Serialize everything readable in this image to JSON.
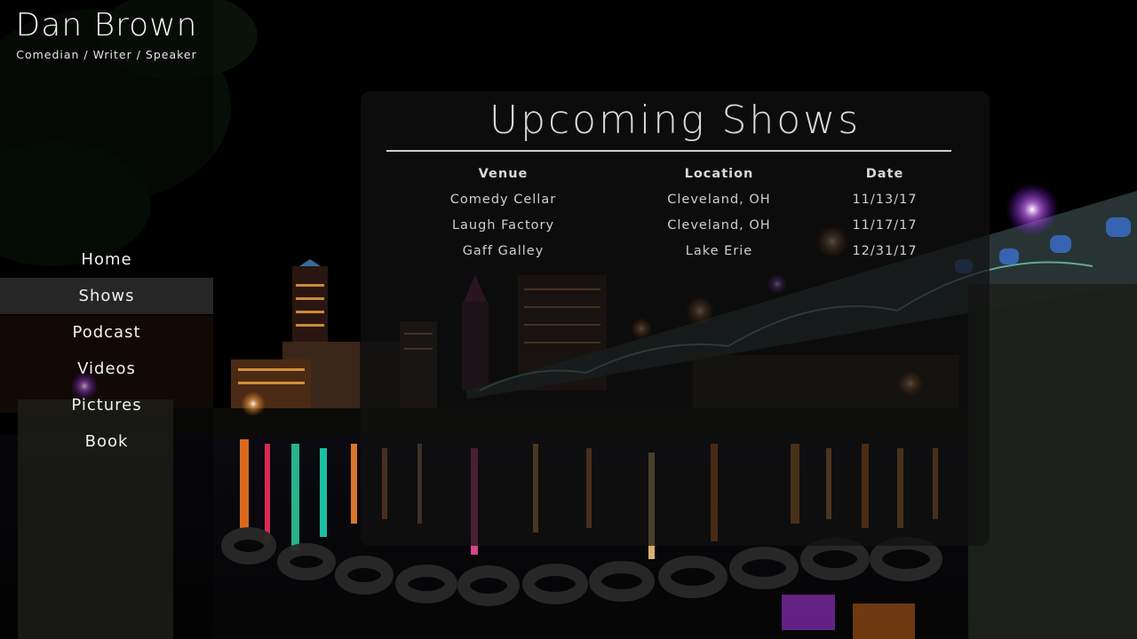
{
  "site": {
    "name": "Dan Brown",
    "tagline": "Comedian / Writer / Speaker"
  },
  "nav": {
    "items": [
      {
        "label": "Home"
      },
      {
        "label": "Shows"
      },
      {
        "label": "Podcast"
      },
      {
        "label": "Videos"
      },
      {
        "label": "Pictures"
      },
      {
        "label": "Book"
      }
    ],
    "active": "Shows"
  },
  "shows": {
    "title": "Upcoming Shows",
    "columns": [
      "Venue",
      "Location",
      "Date"
    ],
    "rows": [
      {
        "venue": "Comedy Cellar",
        "location": "Cleveland, OH",
        "date": "11/13/17"
      },
      {
        "venue": "Laugh Factory",
        "location": "Cleveland, OH",
        "date": "11/17/17"
      },
      {
        "venue": "Gaff Galley",
        "location": "Lake Erie",
        "date": "12/31/17"
      }
    ]
  },
  "colors": {
    "background": "#000000",
    "text": "#eaeaea",
    "nav_active_bg": "#464646",
    "panel_bg": "#101010"
  }
}
